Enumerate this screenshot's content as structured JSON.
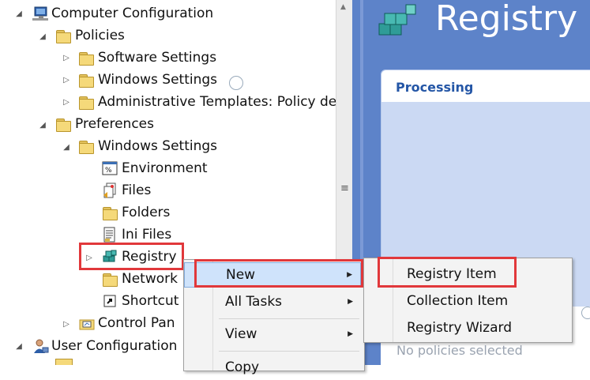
{
  "tree": {
    "computer_config": "Computer Configuration",
    "policies": "Policies",
    "software_settings": "Software Settings",
    "windows_settings": "Windows Settings",
    "admin_templates": "Administrative Templates: Policy de",
    "preferences": "Preferences",
    "pref_windows_settings": "Windows Settings",
    "environment": "Environment",
    "files": "Files",
    "folders": "Folders",
    "ini_files": "Ini Files",
    "registry": "Registry",
    "network": "Network",
    "shortcut": "Shortcut",
    "control_panel": "Control Pan",
    "user_config": "User Configuration"
  },
  "right": {
    "title": "Registry",
    "processing": "Processing",
    "no_policies": "No policies selected"
  },
  "context_menu": {
    "new": "New",
    "all_tasks": "All Tasks",
    "view": "View",
    "copy": "Copy"
  },
  "submenu": {
    "registry_item": "Registry Item",
    "collection_item": "Collection Item",
    "registry_wizard": "Registry Wizard"
  },
  "colors": {
    "highlight": "#e1383b",
    "right_pane": "#5d83c9",
    "panel": "#cbd9f3"
  }
}
